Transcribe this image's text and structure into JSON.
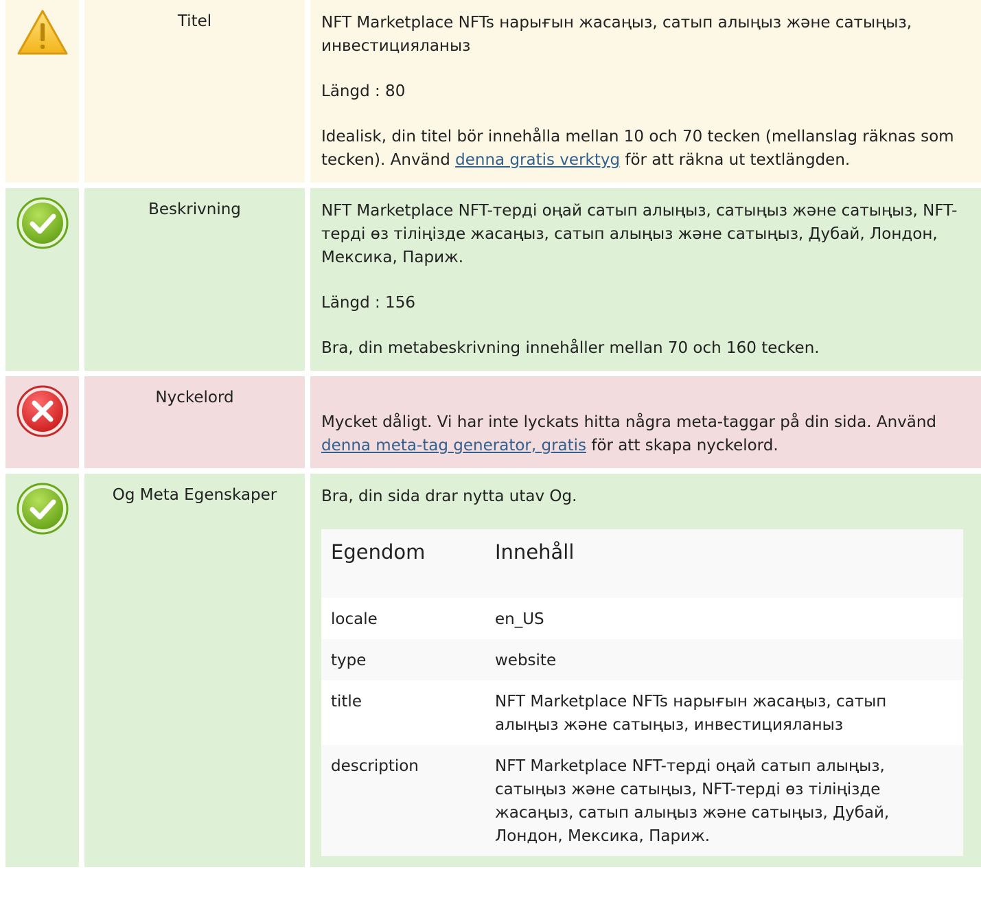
{
  "rows": {
    "title": {
      "label": "Titel",
      "value": "NFT Marketplace NFTs нарығын жасаңыз, сатып алыңыз және сатыңыз, инвестицияланыз",
      "length": "Längd : 80",
      "advice_before": "Idealisk, din titel bör innehålla mellan 10 och 70 tecken (mellanslag räknas som tecken). Använd ",
      "advice_link": "denna gratis verktyg",
      "advice_after": " för att räkna ut textlängden."
    },
    "description": {
      "label": "Beskrivning",
      "value": "NFT Marketplace NFT-терді оңай сатып алыңыз, сатыңыз және сатыңыз, NFT-терді өз тіліңізде жасаңыз, сатып алыңыз және сатыңыз, Дубай, Лондон, Мексика, Париж.",
      "length": "Längd : 156",
      "advice": "Bra, din metabeskrivning innehåller mellan 70 och 160 tecken."
    },
    "keywords": {
      "label": "Nyckelord",
      "advice_before": "Mycket dåligt. Vi har inte lyckats hitta några meta-taggar på din sida. Använd ",
      "advice_link": "denna meta-tag generator, gratis",
      "advice_after": " för att skapa nyckelord."
    },
    "og": {
      "label": "Og Meta Egenskaper",
      "advice": "Bra, din sida drar nytta utav Og.",
      "table": {
        "header_property": "Egendom",
        "header_content": "Innehåll",
        "rows": [
          {
            "property": "locale",
            "content": "en_US"
          },
          {
            "property": "type",
            "content": "website"
          },
          {
            "property": "title",
            "content": "NFT Marketplace NFTs нарығын жасаңыз, сатып алыңыз және сатыңыз, инвестицияланыз"
          },
          {
            "property": "description",
            "content": "NFT Marketplace NFT-терді оңай сатып алыңыз, сатыңыз және сатыңыз, NFT-терді өз тіліңізде жасаңыз, сатып алыңыз және сатыңыз, Дубай, Лондон, Мексика, Париж."
          }
        ]
      }
    }
  },
  "icons": {
    "warning": "warning-icon",
    "success": "check-icon",
    "error": "error-icon"
  },
  "colors": {
    "warning_bg": "#fdf8e5",
    "success_bg": "#def0d6",
    "error_bg": "#f2dcdd",
    "link": "#33608f"
  }
}
